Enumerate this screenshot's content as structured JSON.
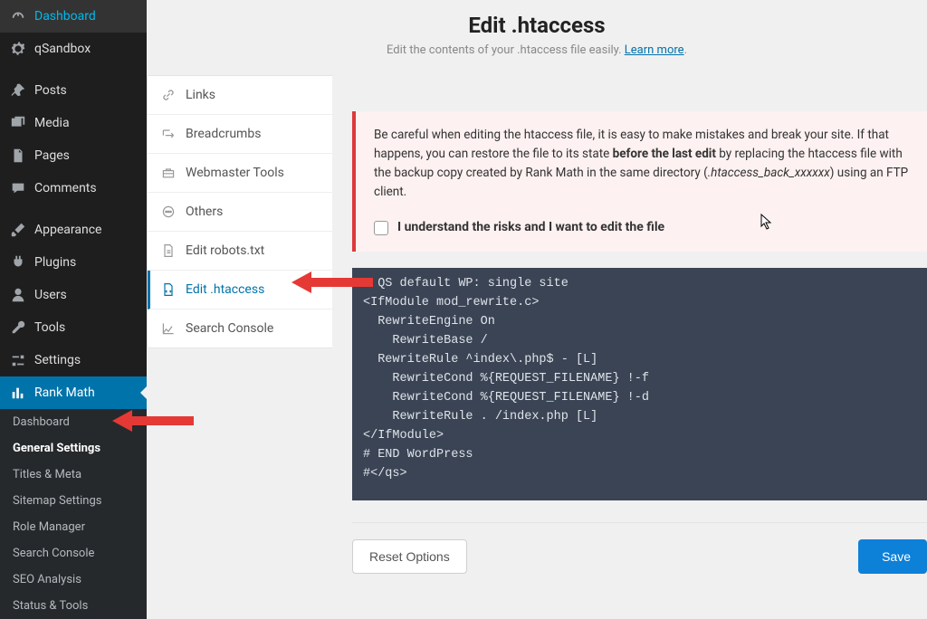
{
  "header": {
    "title": "Edit .htaccess",
    "subtitle_pre": "Edit the contents of your .htaccess file easily. ",
    "learn_more": "Learn more"
  },
  "wp_menu": [
    {
      "icon": "dashboard",
      "label": "Dashboard"
    },
    {
      "icon": "gear",
      "label": "qSandbox"
    },
    {
      "icon": "pushpin",
      "label": "Posts"
    },
    {
      "icon": "media",
      "label": "Media"
    },
    {
      "icon": "page",
      "label": "Pages"
    },
    {
      "icon": "comment",
      "label": "Comments"
    },
    {
      "icon": "brush",
      "label": "Appearance"
    },
    {
      "icon": "plugin",
      "label": "Plugins"
    },
    {
      "icon": "user",
      "label": "Users"
    },
    {
      "icon": "wrench",
      "label": "Tools"
    },
    {
      "icon": "sliders",
      "label": "Settings"
    },
    {
      "icon": "chart",
      "label": "Rank Math",
      "active": true
    }
  ],
  "wp_submenu": [
    {
      "label": "Dashboard"
    },
    {
      "label": "General Settings",
      "bold": true
    },
    {
      "label": "Titles & Meta"
    },
    {
      "label": "Sitemap Settings"
    },
    {
      "label": "Role Manager"
    },
    {
      "label": "Search Console"
    },
    {
      "label": "SEO Analysis"
    },
    {
      "label": "Status & Tools"
    }
  ],
  "tabs": [
    {
      "icon": "link",
      "label": "Links"
    },
    {
      "icon": "breadcrumb",
      "label": "Breadcrumbs"
    },
    {
      "icon": "toolbox",
      "label": "Webmaster Tools"
    },
    {
      "icon": "dots",
      "label": "Others"
    },
    {
      "icon": "filedoc",
      "label": "Edit robots.txt"
    },
    {
      "icon": "filecode",
      "label": "Edit .htaccess",
      "active": true
    },
    {
      "icon": "graph",
      "label": "Search Console"
    }
  ],
  "warning": {
    "line1_pre": "Be careful when editing the htaccess file, it is easy to make mistakes and break your site. If that happens, you can restore the file to its state ",
    "bold": "before the last edit",
    "line1_post": " by replacing the htaccess file with the backup copy created by Rank Math in the same directory (",
    "italic": ".htaccess_back_xxxxxx",
    "line1_end": ") using an FTP client.",
    "checkbox_label": "I understand the risks and I want to edit the file"
  },
  "code": "# QS default WP: single site\n<IfModule mod_rewrite.c>\n  RewriteEngine On\n    RewriteBase /\n  RewriteRule ^index\\.php$ - [L]\n    RewriteCond %{REQUEST_FILENAME} !-f\n    RewriteCond %{REQUEST_FILENAME} !-d\n    RewriteRule . /index.php [L]\n</IfModule>\n# END WordPress\n#</qs>",
  "buttons": {
    "reset": "Reset Options",
    "save": "Save"
  }
}
